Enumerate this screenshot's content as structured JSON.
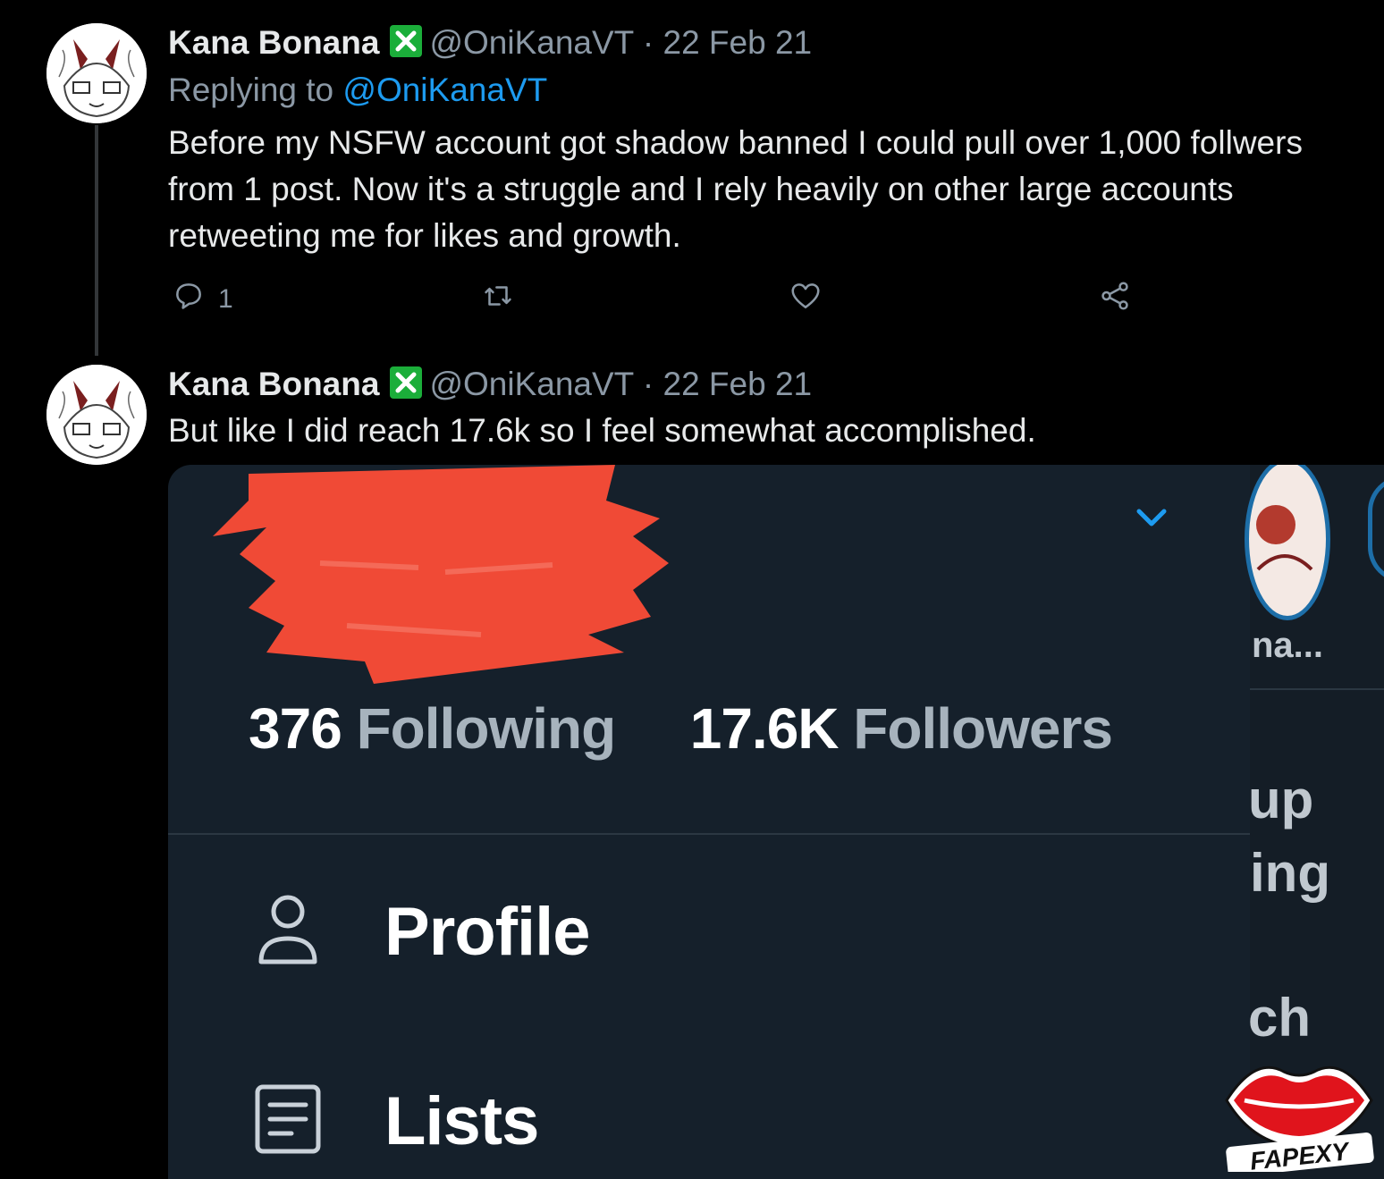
{
  "tweets": [
    {
      "author_name": "Kana Bonana",
      "verified_icon": "x-mark-badge-icon",
      "handle": "@OniKanaVT",
      "separator": "·",
      "date": "22 Feb 21",
      "replying_to_label": "Replying to",
      "replying_to_handle": "@OniKanaVT",
      "text": "Before my NSFW account got shadow banned I could pull over 1,000 follwers from 1 post. Now it's a struggle and I rely heavily on other large accounts retweeting me for likes and growth.",
      "actions": {
        "reply_count": "1",
        "retweet_count": "",
        "like_count": ""
      }
    },
    {
      "author_name": "Kana Bonana",
      "verified_icon": "x-mark-badge-icon",
      "handle": "@OniKanaVT",
      "separator": "·",
      "date": "22 Feb 21",
      "text": "But like I did reach 17.6k so I feel somewhat accomplished."
    }
  ],
  "embedded_screenshot": {
    "following_count": "376",
    "following_label": "Following",
    "followers_count": "17.6K",
    "followers_label": "Followers",
    "menu": [
      {
        "label": "Profile",
        "icon": "person-icon"
      },
      {
        "label": "Lists",
        "icon": "list-document-icon"
      }
    ],
    "partial_texts": [
      "na...",
      "up",
      "ing",
      "ch"
    ],
    "redaction_color": "#f04a36"
  },
  "watermark": {
    "text": "FAPEXY"
  },
  "colors": {
    "background": "#000000",
    "mention": "#1d9bf0",
    "muted": "#8b98a5",
    "verified": "#1bae3a",
    "embed_background": "#15202b"
  }
}
